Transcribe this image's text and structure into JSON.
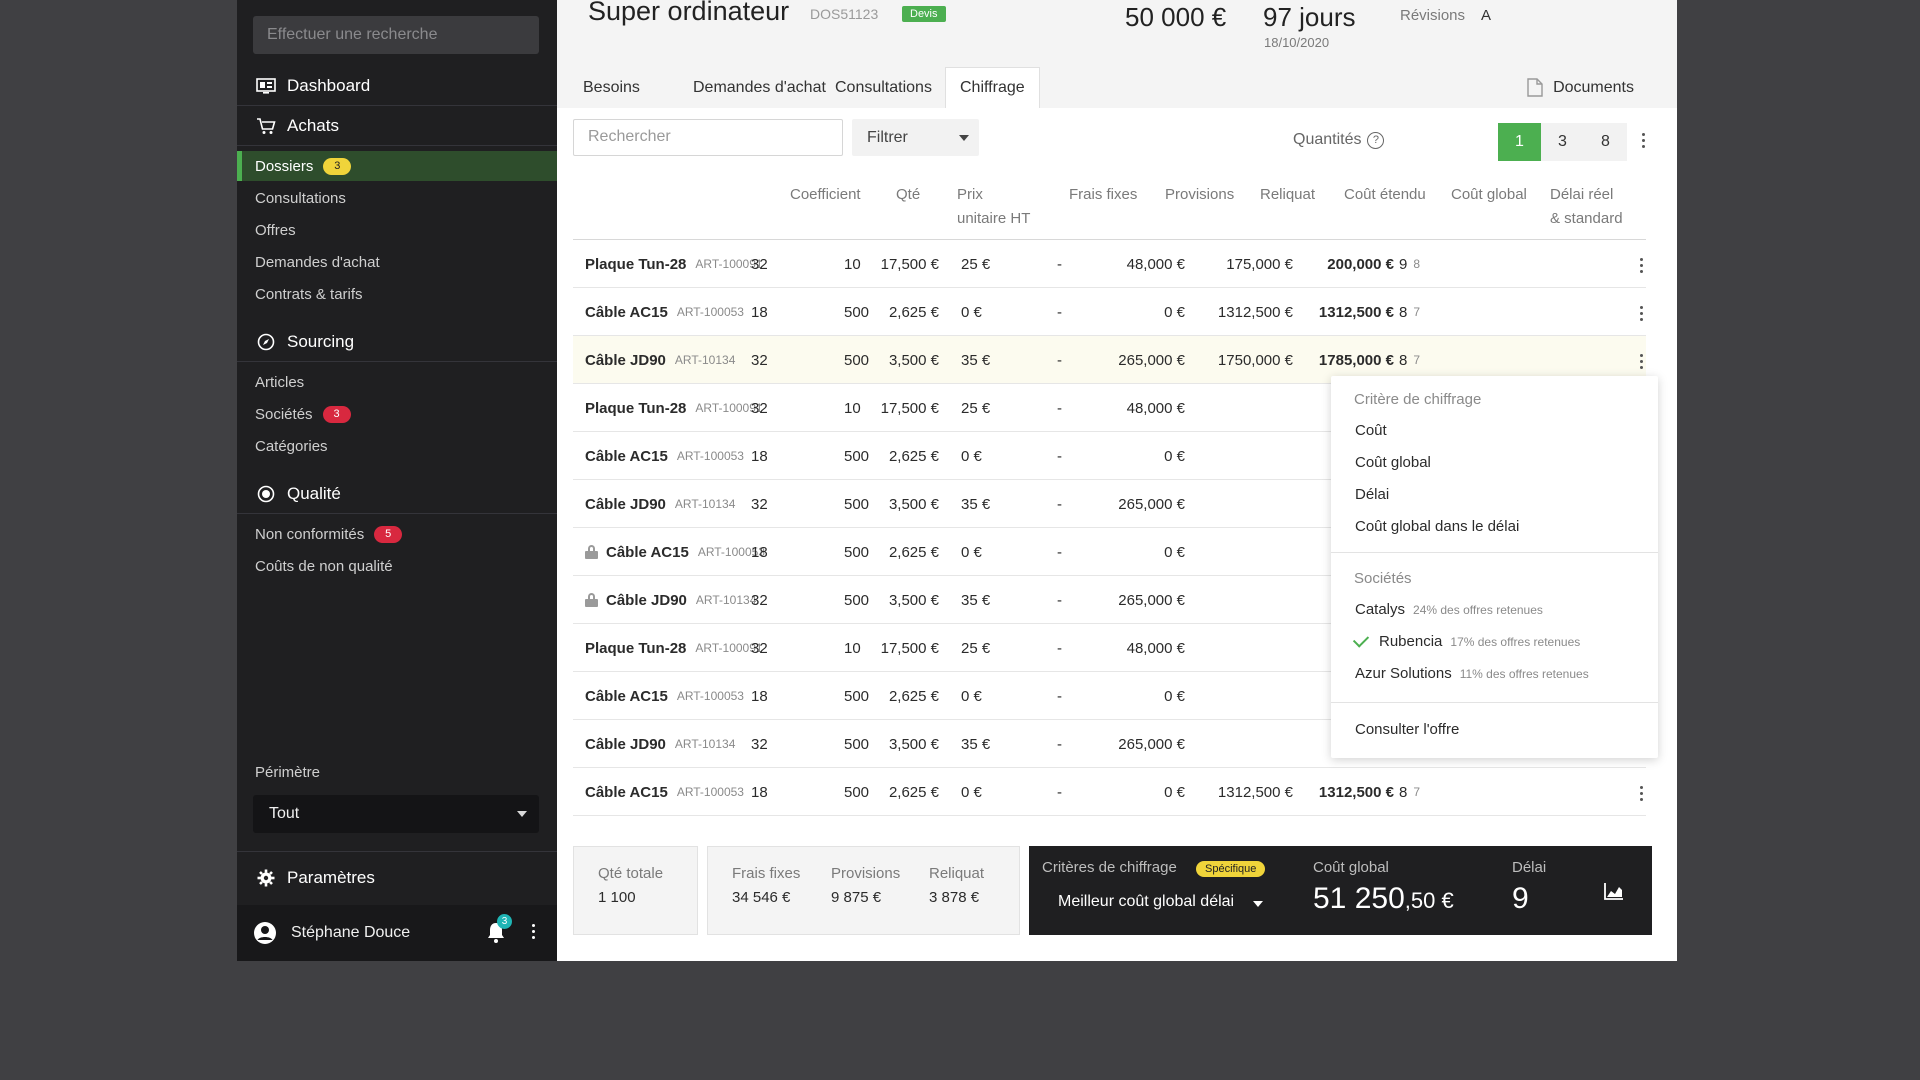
{
  "sidebar": {
    "search_placeholder": "Effectuer une recherche",
    "dashboard": "Dashboard",
    "achats": "Achats",
    "achats_items": [
      {
        "label": "Dossiers",
        "badge": "3"
      },
      {
        "label": "Consultations"
      },
      {
        "label": "Offres"
      },
      {
        "label": "Demandes d'achat"
      },
      {
        "label": "Contrats & tarifs"
      }
    ],
    "sourcing": "Sourcing",
    "sourcing_items": [
      {
        "label": "Articles"
      },
      {
        "label": "Sociétés",
        "badge": "3"
      },
      {
        "label": "Catégories"
      }
    ],
    "qualite": "Qualité",
    "qualite_items": [
      {
        "label": "Non conformités",
        "badge": "5"
      },
      {
        "label": "Coûts de non qualité"
      }
    ],
    "perimetre_label": "Périmètre",
    "perimetre_value": "Tout",
    "parametres": "Paramètres",
    "user_name": "Stéphane Douce",
    "notif_count": "3"
  },
  "header": {
    "title": "Super ordinateur",
    "ref": "DOS51123",
    "status": "Devis",
    "amount": "50 000 €",
    "days": "97 jours",
    "date": "18/10/2020",
    "revisions_label": "Révisions",
    "revisions_value": "A"
  },
  "tabs": [
    "Besoins",
    "Demandes d'achat",
    "Consultations",
    "Chiffrage"
  ],
  "active_tab": "Chiffrage",
  "documents_label": "Documents",
  "toolbar": {
    "search_placeholder": "Rechercher",
    "filter_label": "Filtrer",
    "quantities_label": "Quantités",
    "quantities": [
      "1",
      "3",
      "8"
    ],
    "quantity_selected": "1"
  },
  "table": {
    "headers": {
      "coefficient": "Coefficient",
      "qte": "Qté",
      "prix_1": "Prix",
      "prix_2": "unitaire HT",
      "frais": "Frais fixes",
      "provisions": "Provisions",
      "reliquat": "Reliquat",
      "cout_etendu": "Coût étendu",
      "cout_global": "Coût global",
      "delai_1": "Délai réel",
      "delai_2": "& standard"
    },
    "rows": [
      {
        "name": "Plaque Tun-28",
        "ref": "ART-100091",
        "coef": "32",
        "qte": "10",
        "prix": "17,500 €",
        "frais": "25 €",
        "prov": "-",
        "reliquat": "48,000 €",
        "etendu": "175,000 €",
        "global": "200,000 €",
        "delai": "9",
        "std": "8"
      },
      {
        "name": "Câble AC15",
        "ref": "ART-100053",
        "coef": "18",
        "qte": "500",
        "prix": "2,625 €",
        "frais": "0 €",
        "prov": "-",
        "reliquat": "0 €",
        "etendu": "1312,500 €",
        "global": "1312,500 €",
        "delai": "8",
        "std": "7"
      },
      {
        "name": "Câble JD90",
        "ref": "ART-10134",
        "coef": "32",
        "qte": "500",
        "prix": "3,500 €",
        "frais": "35 €",
        "prov": "-",
        "reliquat": "265,000 €",
        "etendu": "1750,000 €",
        "global": "1785,000 €",
        "delai": "8",
        "std": "7"
      },
      {
        "name": "Plaque Tun-28",
        "ref": "ART-100091",
        "coef": "32",
        "qte": "10",
        "prix": "17,500 €",
        "frais": "25 €",
        "prov": "-",
        "reliquat": "48,000 €"
      },
      {
        "name": "Câble AC15",
        "ref": "ART-100053",
        "coef": "18",
        "qte": "500",
        "prix": "2,625 €",
        "frais": "0 €",
        "prov": "-",
        "reliquat": "0 €"
      },
      {
        "name": "Câble JD90",
        "ref": "ART-10134",
        "coef": "32",
        "qte": "500",
        "prix": "3,500 €",
        "frais": "35 €",
        "prov": "-",
        "reliquat": "265,000 €"
      },
      {
        "name": "Câble AC15",
        "ref": "ART-100053",
        "coef": "18",
        "qte": "500",
        "prix": "2,625 €",
        "frais": "0 €",
        "prov": "-",
        "reliquat": "0 €",
        "locked": true
      },
      {
        "name": "Câble JD90",
        "ref": "ART-10134",
        "coef": "32",
        "qte": "500",
        "prix": "3,500 €",
        "frais": "35 €",
        "prov": "-",
        "reliquat": "265,000 €",
        "locked": true
      },
      {
        "name": "Plaque Tun-28",
        "ref": "ART-100091",
        "coef": "32",
        "qte": "10",
        "prix": "17,500 €",
        "frais": "25 €",
        "prov": "-",
        "reliquat": "48,000 €"
      },
      {
        "name": "Câble AC15",
        "ref": "ART-100053",
        "coef": "18",
        "qte": "500",
        "prix": "2,625 €",
        "frais": "0 €",
        "prov": "-",
        "reliquat": "0 €"
      },
      {
        "name": "Câble JD90",
        "ref": "ART-10134",
        "coef": "32",
        "qte": "500",
        "prix": "3,500 €",
        "frais": "35 €",
        "prov": "-",
        "reliquat": "265,000 €"
      },
      {
        "name": "Câble AC15",
        "ref": "ART-100053",
        "coef": "18",
        "qte": "500",
        "prix": "2,625 €",
        "frais": "0 €",
        "prov": "-",
        "reliquat": "0 €",
        "etendu": "1312,500 €",
        "global": "1312,500 €",
        "delai": "8",
        "std": "7"
      }
    ]
  },
  "menu": {
    "critere_title": "Critère de chiffrage",
    "criteres": [
      "Coût",
      "Coût global",
      "Délai",
      "Coût global dans le délai"
    ],
    "societes_title": "Sociétés",
    "societes": [
      {
        "name": "Catalys",
        "share": "24% des offres retenues"
      },
      {
        "name": "Rubencia",
        "share": "17% des offres retenues",
        "checked": true
      },
      {
        "name": "Azur Solutions",
        "share": "11% des offres retenues"
      }
    ],
    "consulter": "Consulter l'offre"
  },
  "summary": {
    "qte_label": "Qté totale",
    "qte_value": "1 100",
    "frais_label": "Frais fixes",
    "frais_value": "34 546 €",
    "prov_label": "Provisions",
    "prov_value": "9 875 €",
    "reliquat_label": "Reliquat",
    "reliquat_value": "3 878 €",
    "criteres_label": "Critères de chiffrage",
    "criteres_badge": "Spécifique",
    "criteres_value": "Meilleur coût global délai",
    "cout_label": "Coût global",
    "cout_int": "51 250",
    "cout_dec": ",50 €",
    "delai_label": "Délai",
    "delai_value": "9"
  }
}
